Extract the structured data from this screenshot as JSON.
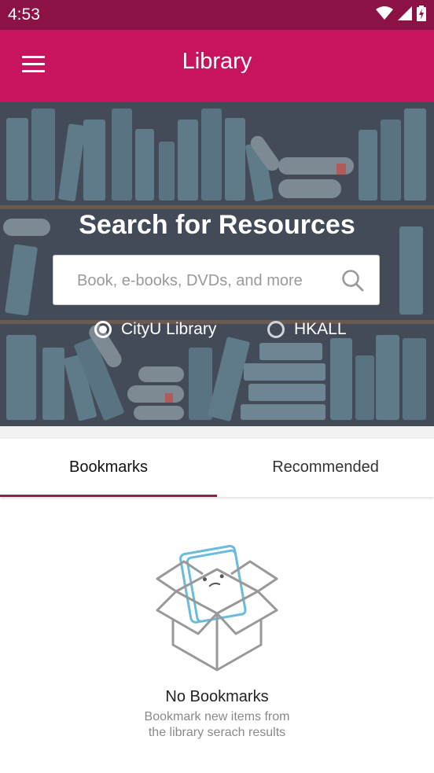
{
  "status_bar": {
    "time": "4:53"
  },
  "app_bar": {
    "title": "Library"
  },
  "hero": {
    "title": "Search for Resources",
    "search_placeholder": "Book, e-books, DVDs, and more",
    "radio_options": [
      {
        "label": "CityU Library",
        "selected": true
      },
      {
        "label": "HKALL",
        "selected": false
      }
    ]
  },
  "tabs": [
    {
      "label": "Bookmarks",
      "active": true
    },
    {
      "label": "Recommended",
      "active": false
    }
  ],
  "empty_state": {
    "title": "No Bookmarks",
    "subtitle_line1": "Bookmark new items from",
    "subtitle_line2": "the library serach results"
  },
  "colors": {
    "status_bar": "#8c1246",
    "app_bar": "#c8145e",
    "hero_bg": "#444b58",
    "tab_indicator": "#a0184f"
  },
  "icons": [
    "menu-icon",
    "search-icon",
    "wifi-icon",
    "signal-icon",
    "battery-icon",
    "empty-box-illustration"
  ]
}
